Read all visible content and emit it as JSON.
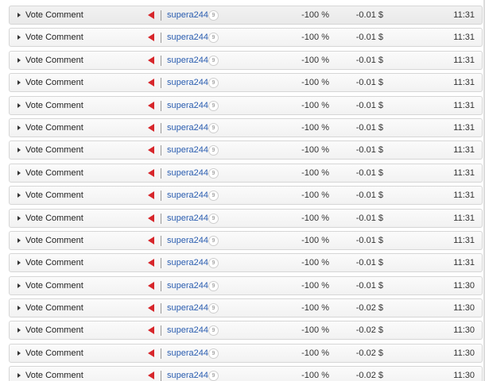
{
  "rows": [
    {
      "op": "Vote Comment",
      "user": "supera244",
      "rep": "9",
      "pct": "-100 %",
      "val": "-0.01 $",
      "time": "11:31"
    },
    {
      "op": "Vote Comment",
      "user": "supera244",
      "rep": "9",
      "pct": "-100 %",
      "val": "-0.01 $",
      "time": "11:31"
    },
    {
      "op": "Vote Comment",
      "user": "supera244",
      "rep": "9",
      "pct": "-100 %",
      "val": "-0.01 $",
      "time": "11:31"
    },
    {
      "op": "Vote Comment",
      "user": "supera244",
      "rep": "9",
      "pct": "-100 %",
      "val": "-0.01 $",
      "time": "11:31"
    },
    {
      "op": "Vote Comment",
      "user": "supera244",
      "rep": "9",
      "pct": "-100 %",
      "val": "-0.01 $",
      "time": "11:31"
    },
    {
      "op": "Vote Comment",
      "user": "supera244",
      "rep": "9",
      "pct": "-100 %",
      "val": "-0.01 $",
      "time": "11:31"
    },
    {
      "op": "Vote Comment",
      "user": "supera244",
      "rep": "9",
      "pct": "-100 %",
      "val": "-0.01 $",
      "time": "11:31"
    },
    {
      "op": "Vote Comment",
      "user": "supera244",
      "rep": "9",
      "pct": "-100 %",
      "val": "-0.01 $",
      "time": "11:31"
    },
    {
      "op": "Vote Comment",
      "user": "supera244",
      "rep": "9",
      "pct": "-100 %",
      "val": "-0.01 $",
      "time": "11:31"
    },
    {
      "op": "Vote Comment",
      "user": "supera244",
      "rep": "9",
      "pct": "-100 %",
      "val": "-0.01 $",
      "time": "11:31"
    },
    {
      "op": "Vote Comment",
      "user": "supera244",
      "rep": "9",
      "pct": "-100 %",
      "val": "-0.01 $",
      "time": "11:31"
    },
    {
      "op": "Vote Comment",
      "user": "supera244",
      "rep": "9",
      "pct": "-100 %",
      "val": "-0.01 $",
      "time": "11:31"
    },
    {
      "op": "Vote Comment",
      "user": "supera244",
      "rep": "9",
      "pct": "-100 %",
      "val": "-0.01 $",
      "time": "11:30"
    },
    {
      "op": "Vote Comment",
      "user": "supera244",
      "rep": "9",
      "pct": "-100 %",
      "val": "-0.02 $",
      "time": "11:30"
    },
    {
      "op": "Vote Comment",
      "user": "supera244",
      "rep": "9",
      "pct": "-100 %",
      "val": "-0.02 $",
      "time": "11:30"
    },
    {
      "op": "Vote Comment",
      "user": "supera244",
      "rep": "9",
      "pct": "-100 %",
      "val": "-0.02 $",
      "time": "11:30"
    },
    {
      "op": "Vote Comment",
      "user": "supera244",
      "rep": "9",
      "pct": "-100 %",
      "val": "-0.02 $",
      "time": "11:30"
    }
  ],
  "icons": {
    "expand": "caret-right-icon",
    "direction": "downvote-arrow-icon",
    "rep_badge": "reputation-badge"
  },
  "colors": {
    "downvote": "#d7262b",
    "link": "#2a5db0",
    "row_bg": "#f5f5f5",
    "row_border": "#d6d6d6"
  }
}
